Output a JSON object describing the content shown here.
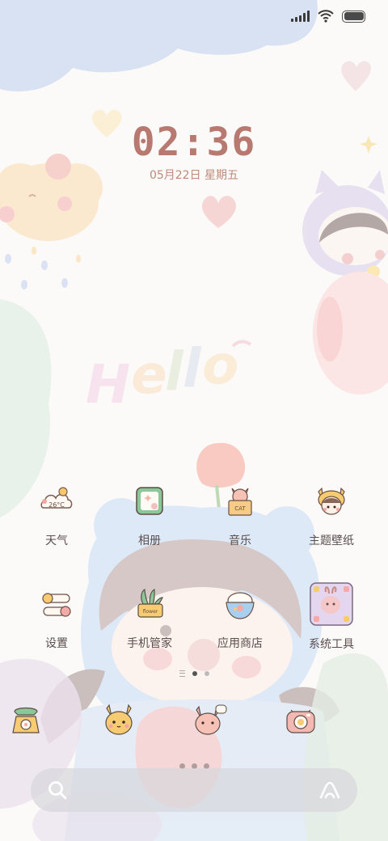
{
  "status_bar": {
    "icons": [
      "signal-bars-icon",
      "wifi-icon",
      "battery-icon"
    ],
    "battery_level": 1.0
  },
  "lock_clock": {
    "time": "02:36",
    "date": "05月22日 星期五"
  },
  "wallpaper_text": "Hello",
  "apps": [
    {
      "label": "天气",
      "icon": "weather-cloud-icon"
    },
    {
      "label": "相册",
      "icon": "photo-frame-icon"
    },
    {
      "label": "音乐",
      "icon": "cat-box-music-icon"
    },
    {
      "label": "主题壁纸",
      "icon": "cat-face-theme-icon"
    },
    {
      "label": "设置",
      "icon": "toggle-switches-icon"
    },
    {
      "label": "手机管家",
      "icon": "plant-pot-icon"
    },
    {
      "label": "应用商店",
      "icon": "rice-bowl-icon"
    },
    {
      "label": "系统工具",
      "icon": "bunny-folder-icon"
    }
  ],
  "dock": [
    {
      "icon": "telephone-icon"
    },
    {
      "icon": "yellow-cat-message-icon"
    },
    {
      "icon": "pink-cat-browser-icon"
    },
    {
      "icon": "camera-icon"
    }
  ],
  "page_indicator": {
    "pages": 2,
    "active_page": 1
  },
  "search_bar": {
    "left_icon": "search-icon",
    "right_icon": "assistant-icon"
  }
}
